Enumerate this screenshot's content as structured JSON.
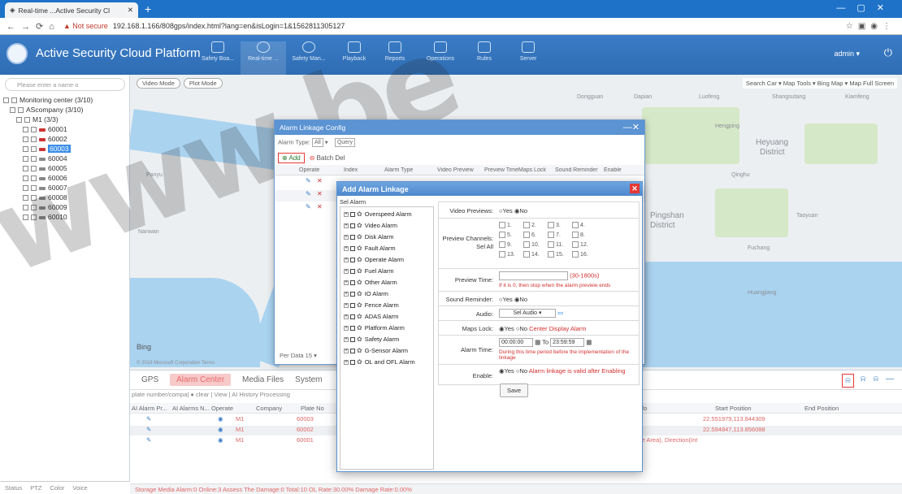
{
  "browser": {
    "tab_title": "Real-time ...Active Security Cl",
    "new_tab": "+",
    "warning": "Not secure",
    "url": "192.168.1.166/808gps/index.html?lang=en&isLogin=1&1562811305127"
  },
  "app": {
    "title": "Active Security Cloud Platform",
    "user": "admin",
    "nav": [
      "Safety Boa...",
      "Real-time ...",
      "Safety Man...",
      "Playback",
      "Reports",
      "Operations",
      "Rules",
      "Server"
    ]
  },
  "left": {
    "search_placeholder": "Please enter a name o",
    "tree": [
      "Monitoring center (3/10)",
      "AScompany (3/10)",
      "M1 (3/3)",
      "60001",
      "60002",
      "60003",
      "60004",
      "60005",
      "60006",
      "60007",
      "60008",
      "60009",
      "60010"
    ],
    "tabs": [
      "Status",
      "PTZ",
      "Color",
      "Voice"
    ]
  },
  "map": {
    "tabs": [
      "Video Mode",
      "Plot Mode"
    ],
    "tools": "Search Car ▾  Map Tools ▾  Bing Map ▾  Map Full Screen",
    "labels": [
      "Dongguan",
      "Dapian",
      "Luofeng",
      "Shangsutang",
      "Kiamfeng",
      "Heyuang",
      "District",
      "Pingshan",
      "District",
      "Huangjiang",
      "Hengping",
      "Qinghu",
      "Nanwan",
      "Taoyuan",
      "Fuchang",
      "Panyu",
      "Bing"
    ],
    "copyright": "© 2019 Microsoft Corporation  Terms"
  },
  "cfg": {
    "title": "Alarm Linkage Config",
    "type_label": "Alarm Type:",
    "type_value": "All",
    "query": "Query",
    "add": "Add",
    "batch_del": "Batch Del",
    "headers": [
      "Operate",
      "Index",
      "Alarm Type",
      "Video Preview",
      "Preview Time",
      "Maps Lock",
      "Sound Reminder",
      "Enable"
    ],
    "pager": "Per Data 15"
  },
  "add": {
    "title": "Add Alarm Linkage",
    "sel_alarm": "Sel Alarm",
    "alarms": [
      "Overspeed Alarm",
      "Video Alarm",
      "Disk Alarm",
      "Fault Alarm",
      "Operate Alarm",
      "Fuel Alarm",
      "Other Alarm",
      "IO Alarm",
      "Fence Alarm",
      "ADAS Alarm",
      "Platform Alarm",
      "Safety Alarm",
      "G-Sensor Alarm",
      "OL and OFL Alarm"
    ],
    "video_previews_label": "Video Previews:",
    "yes": "Yes",
    "no": "No",
    "preview_channels_label": "Preview Channels:",
    "sel_all": "Sel All",
    "channels": [
      "1.",
      "2.",
      "3.",
      "4.",
      "5.",
      "6.",
      "7.",
      "8.",
      "9.",
      "10.",
      "11.",
      "12.",
      "13.",
      "14.",
      "15.",
      "16."
    ],
    "preview_time_label": "Preview Time:",
    "preview_time_hint": "(30-1800s)",
    "preview_time_note": "If it is 0, then stop when the alarm preview ends",
    "sound_label": "Sound Reminder:",
    "audio_label": "Audio:",
    "audio_value": "Sel Audio",
    "maps_lock_label": "Maps Lock:",
    "maps_lock_note": "Center Display Alarm",
    "alarm_time_label": "Alarm Time:",
    "time_from": "00:00:00",
    "time_to_label": "To",
    "time_to": "23:59:59",
    "alarm_time_note": "During this time period before the implementation of the linkage",
    "enable_label": "Enable:",
    "enable_note": "Alarm linkage is valid after Enabling",
    "save": "Save"
  },
  "bottom": {
    "tabs": [
      "GPS",
      "Alarm Center",
      "Media Files",
      "System"
    ],
    "filter": "plate number/compa| ● clear  | View  | AI History Processing  ",
    "headers": [
      "AI Alarm Pr...",
      "AI Alarms N...",
      "Operate",
      "Company",
      "Plate No",
      "fo",
      "Start Position",
      "End Position"
    ],
    "rows": [
      {
        "company": "M1",
        "plate": "60003",
        "start": "22.551979,113.844309",
        "info": ""
      },
      {
        "company": "M1",
        "plate": "60002",
        "start": "22.594847,113.856088",
        "info": ""
      },
      {
        "company": "M1",
        "plate": "60001",
        "start": "",
        "info": "ircle Area), Direction(Int"
      }
    ],
    "status": "Storage Media Alarm:0   Online:3   Assess The Damage:0   Total:10   OL Rate:30.00%   Damage Rate:0.00%"
  },
  "watermark": "www.be"
}
